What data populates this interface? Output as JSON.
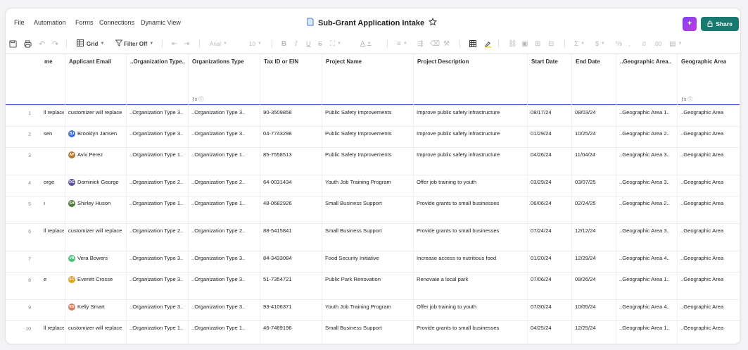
{
  "menu": {
    "file": "File",
    "automation": "Automation",
    "forms": "Forms",
    "connections": "Connections",
    "dynamic_view": "Dynamic View"
  },
  "title": "Sub-Grant Application Intake",
  "share_label": "Share",
  "toolbar": {
    "view_label": "Grid",
    "filter_label": "Filter Off",
    "font_name": "Arial",
    "font_size": "10"
  },
  "columns": [
    {
      "label": "me"
    },
    {
      "label": "Applicant Email"
    },
    {
      "label": "..Organization Type.."
    },
    {
      "label": "Organizations Type"
    },
    {
      "label": "Tax ID or EIN"
    },
    {
      "label": "Project Name"
    },
    {
      "label": "Project Description"
    },
    {
      "label": "Start Date"
    },
    {
      "label": "End Date"
    },
    {
      "label": "..Geographic Area.."
    },
    {
      "label": "Geographic Area"
    }
  ],
  "rows": [
    {
      "num": "1",
      "name": "ll replace",
      "email": "customizer will replace",
      "avatar": "",
      "orgA": "..Organization Type 3..",
      "orgB": "..Organization Type 3..",
      "tax": "90-3509858",
      "project": "Public Safety Improvements",
      "desc": "Improve public safety infrastructure",
      "start": "08/17/24",
      "end": "08/03/24",
      "geoA": "..Geographic Area 1..",
      "geoB": "..Geographic Area"
    },
    {
      "num": "2",
      "name": "sen",
      "email": "Brooklyn Jansen",
      "avatar": "BJ",
      "avatar_color": "#3b6fd8",
      "orgA": "..Organization Type 3..",
      "orgB": "..Organization Type 3..",
      "tax": "04-7743298",
      "project": "Public Safety Improvements",
      "desc": "Improve public safety infrastructure",
      "start": "01/29/24",
      "end": "10/25/24",
      "geoA": "..Geographic Area 2..",
      "geoB": "..Geographic Area"
    },
    {
      "num": "3",
      "name": "",
      "email": "Aviv Perez",
      "avatar": "AP",
      "avatar_color": "#b07a2c",
      "orgA": "..Organization Type 1..",
      "orgB": "..Organization Type 1..",
      "tax": "85-7558513",
      "project": "Public Safety Improvements",
      "desc": "Improve public safety infrastructure",
      "start": "04/26/24",
      "end": "11/04/24",
      "geoA": "..Geographic Area 3..",
      "geoB": "..Geographic Area"
    },
    {
      "num": "4",
      "name": "orge",
      "email": "Dominick George",
      "avatar": "DG",
      "avatar_color": "#5b4d9e",
      "orgA": "..Organization Type 2..",
      "orgB": "..Organization Type 2..",
      "tax": "64-0031434",
      "project": "Youth Job Training Program",
      "desc": "Offer job training to youth",
      "start": "03/29/24",
      "end": "03/07/25",
      "geoA": "..Geographic Area 3..",
      "geoB": "..Geographic Area"
    },
    {
      "num": "5",
      "name": "ı",
      "email": "Shirley Huson",
      "avatar": "SH",
      "avatar_color": "#4f7a3a",
      "orgA": "..Organization Type 1..",
      "orgB": "..Organization Type 1..",
      "tax": "48-0682926",
      "project": "Small Business Support",
      "desc": "Provide grants to small businesses",
      "start": "06/06/24",
      "end": "02/24/25",
      "geoA": "..Geographic Area 2..",
      "geoB": "..Geographic Area"
    },
    {
      "num": "6",
      "name": "ll replace",
      "email": "customizer will replace",
      "avatar": "",
      "orgA": "..Organization Type 2..",
      "orgB": "..Organization Type 2..",
      "tax": "88-5415841",
      "project": "Small Business Support",
      "desc": "Provide grants to small businesses",
      "start": "07/24/24",
      "end": "12/12/24",
      "geoA": "..Geographic Area 3..",
      "geoB": "..Geographic Area"
    },
    {
      "num": "7",
      "name": "",
      "email": "Vera Bowers",
      "avatar": "VB",
      "avatar_color": "#4fc07a",
      "orgA": "..Organization Type 3..",
      "orgB": "..Organization Type 3..",
      "tax": "84-3433084",
      "project": "Food Security Initiative",
      "desc": "Increase access to nutritious food",
      "start": "01/20/24",
      "end": "12/29/24",
      "geoA": "..Geographic Area 4..",
      "geoB": "..Geographic Area"
    },
    {
      "num": "8",
      "name": "e",
      "email": "Everett Crosse",
      "avatar": "EC",
      "avatar_color": "#e0a024",
      "orgA": "..Organization Type 3..",
      "orgB": "..Organization Type 3..",
      "tax": "51-7354721",
      "project": "Public Park Renovation",
      "desc": "Renovate a local park",
      "start": "07/06/24",
      "end": "09/26/24",
      "geoA": "..Geographic Area 1..",
      "geoB": "..Geographic Area"
    },
    {
      "num": "9",
      "name": "",
      "email": "Kelly Smart",
      "avatar": "KS",
      "avatar_color": "#d87a5a",
      "orgA": "..Organization Type 3..",
      "orgB": "..Organization Type 3..",
      "tax": "93-4106371",
      "project": "Youth Job Training Program",
      "desc": "Offer job training to youth",
      "start": "07/30/24",
      "end": "10/05/24",
      "geoA": "..Geographic Area 4..",
      "geoB": "..Geographic Area"
    },
    {
      "num": "10",
      "name": "ll replace",
      "email": "customizer will replace",
      "avatar": "",
      "orgA": "..Organization Type 1..",
      "orgB": "..Organization Type 1..",
      "tax": "46-7489196",
      "project": "Small Business Support",
      "desc": "Provide grants to small businesses",
      "start": "04/25/24",
      "end": "12/25/24",
      "geoA": "..Geographic Area 1..",
      "geoB": "..Geographic Area"
    }
  ],
  "colors": {
    "share_bg": "#17796f",
    "header_divider": "#3b5bdb",
    "ai_gradient_start": "#7b3ff2",
    "ai_gradient_end": "#c23de0"
  }
}
